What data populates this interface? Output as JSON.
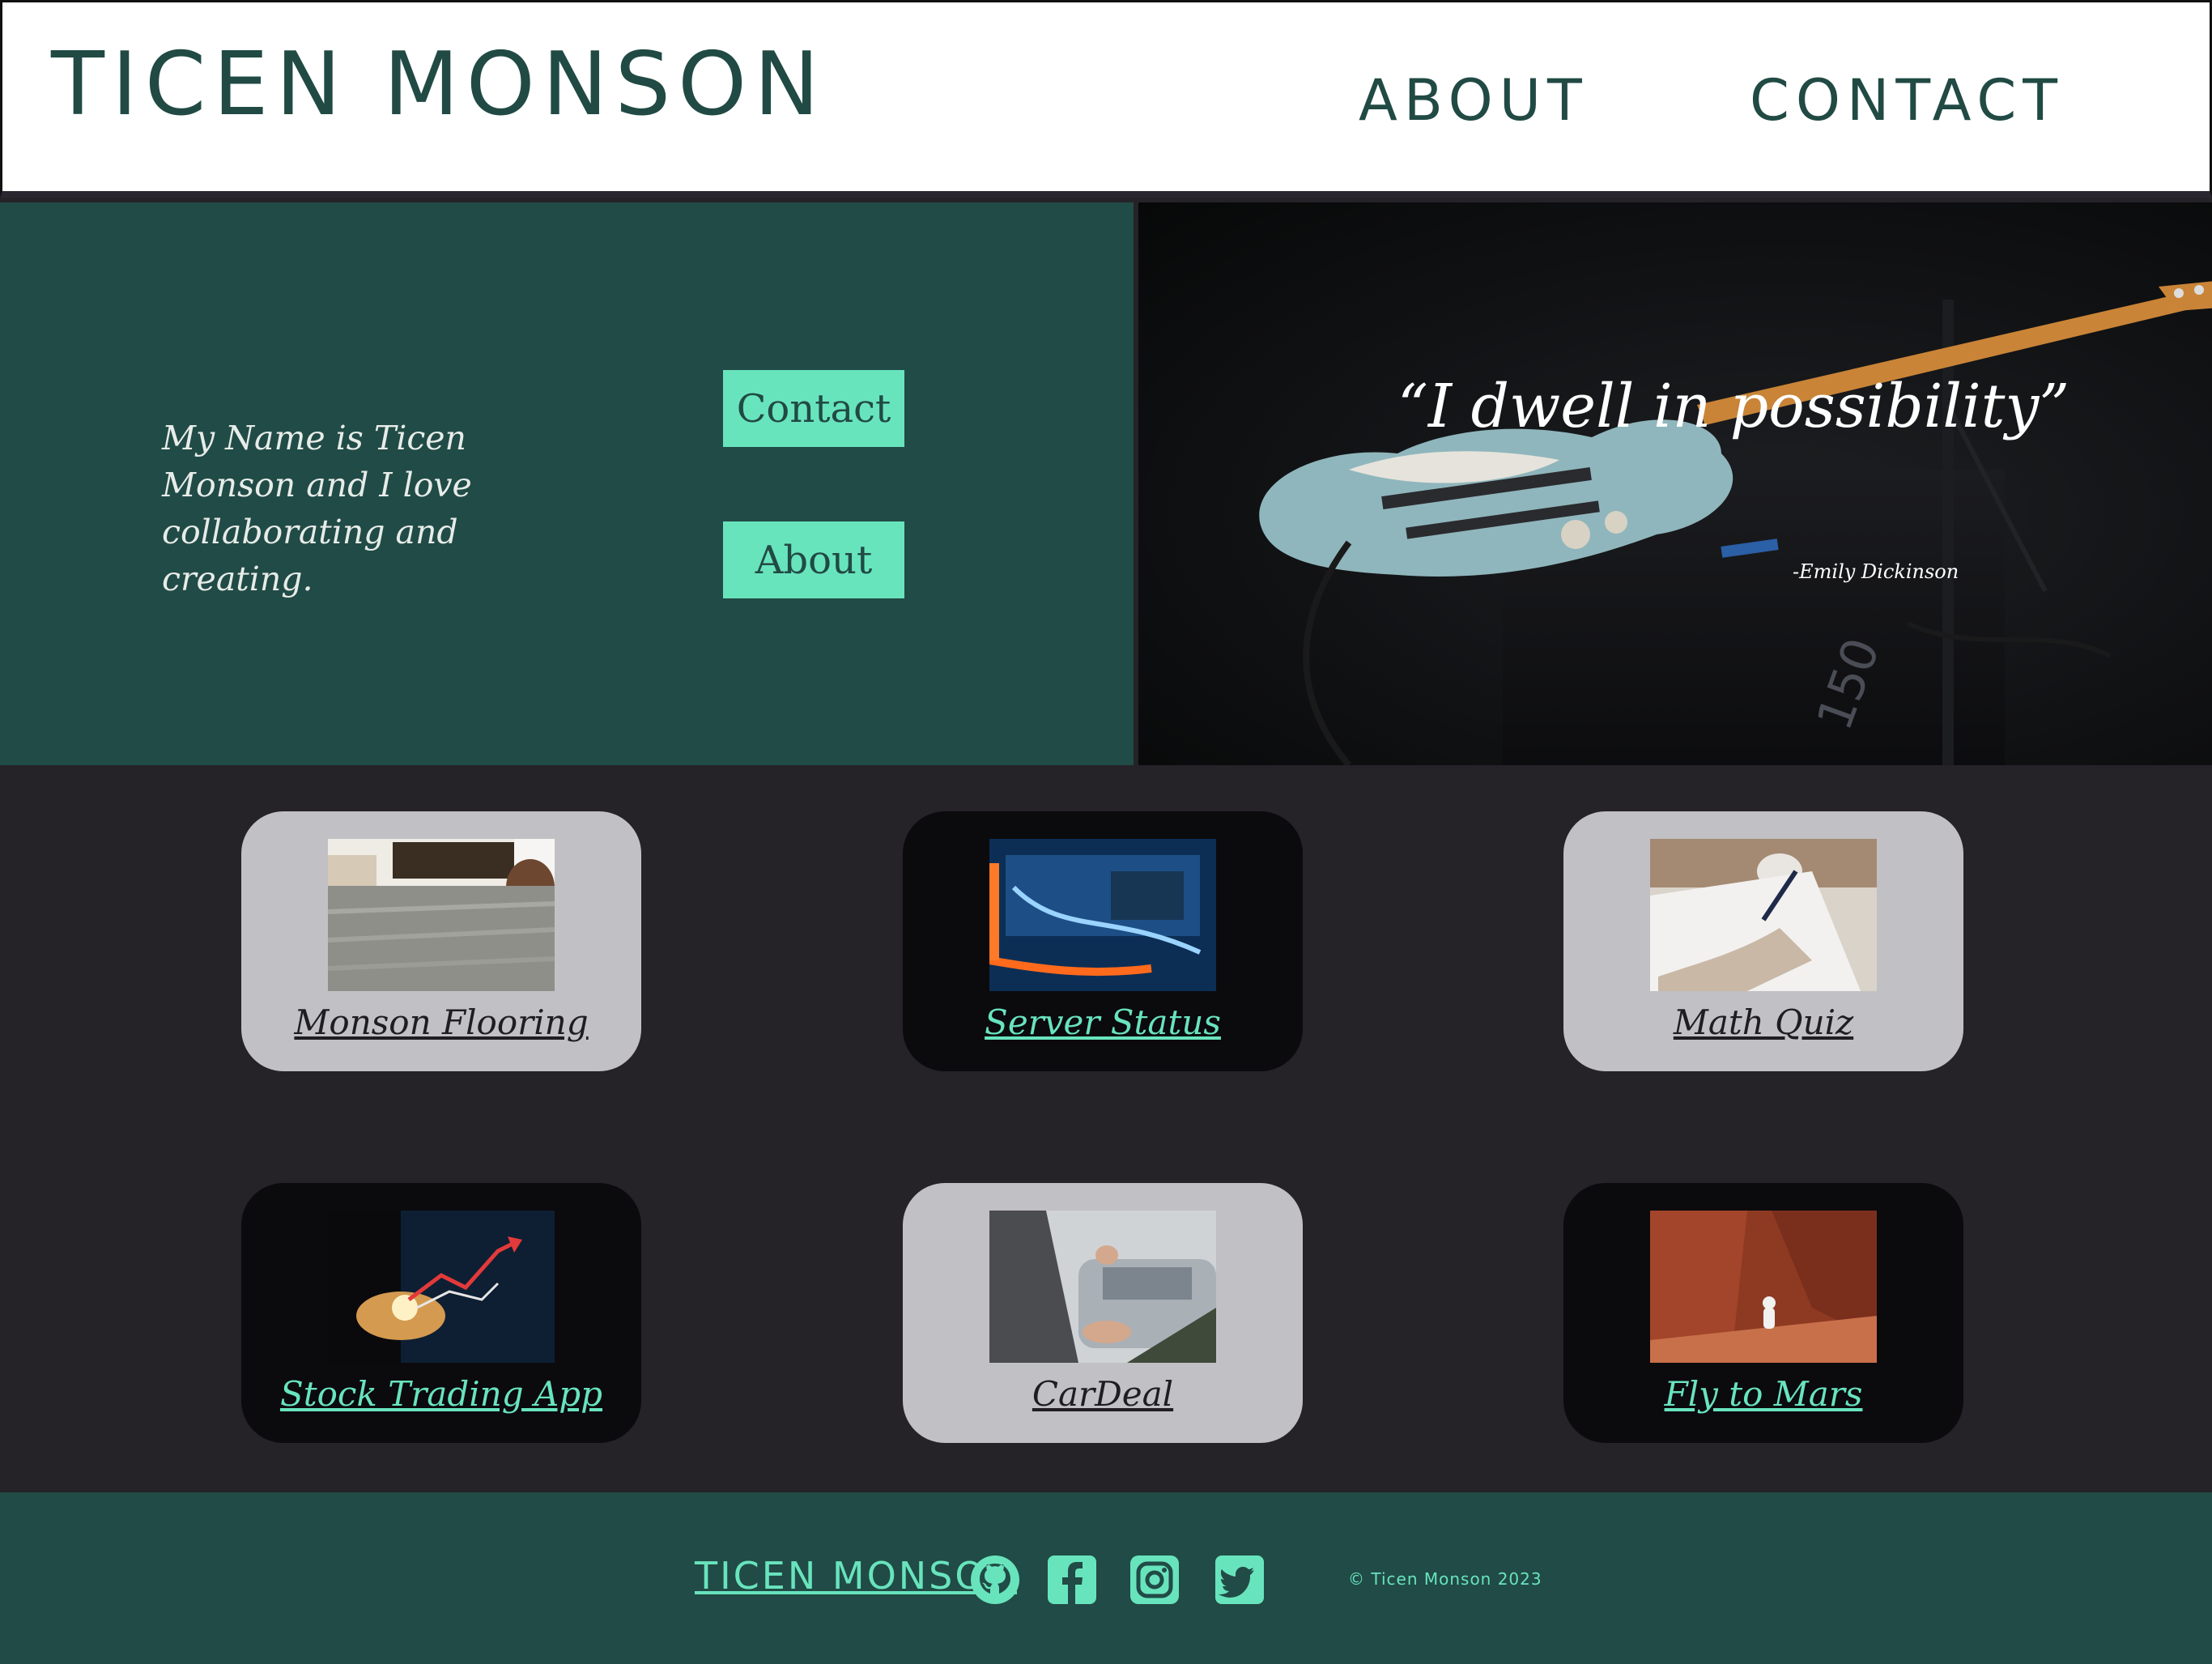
{
  "header": {
    "brand": "Ticen Monson",
    "nav": {
      "about": "About",
      "contact": "Contact"
    }
  },
  "hero": {
    "intro": "My Name is Ticen Monson and I love collaborating and creating.",
    "buttons": {
      "contact": "Contact",
      "about": "About"
    },
    "quote": "“I dwell in possibility”",
    "quote_author": "-Emily Dickinson"
  },
  "projects": [
    {
      "title": "Monson Flooring",
      "style": "light"
    },
    {
      "title": "Server Status",
      "style": "dark"
    },
    {
      "title": "Math Quiz",
      "style": "light"
    },
    {
      "title": "Stock Trading App",
      "style": "dark"
    },
    {
      "title": "CarDeal",
      "style": "light"
    },
    {
      "title": "Fly to Mars",
      "style": "dark"
    }
  ],
  "footer": {
    "brand": "Ticen Monson",
    "social_icons": [
      "github-icon",
      "facebook-icon",
      "instagram-icon",
      "twitter-icon"
    ],
    "copyright": "© Ticen Monson 2023"
  },
  "colors": {
    "brand_dark_green": "#214b46",
    "accent_mint": "#68e4bd",
    "page_dark": "#252228",
    "card_light": "#c1c0c4",
    "card_dark": "#0b0a0d"
  }
}
